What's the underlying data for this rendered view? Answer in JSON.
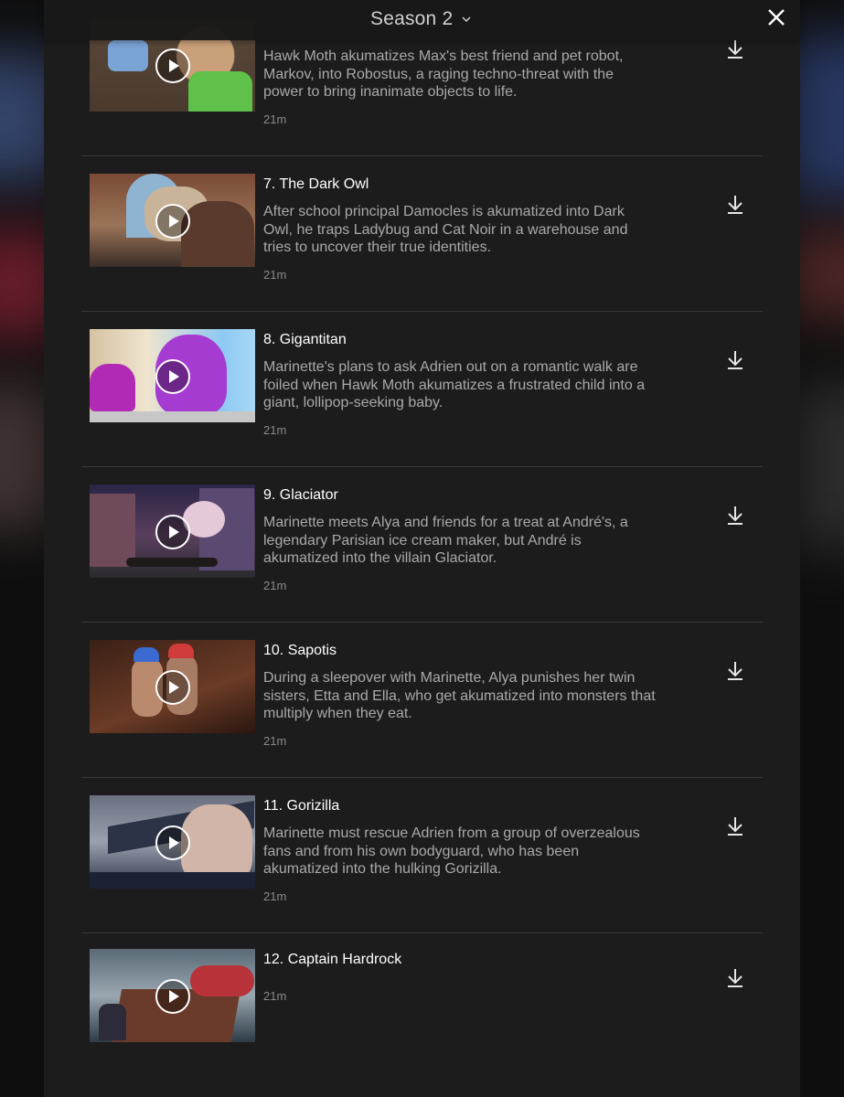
{
  "header": {
    "season_label": "Season 2",
    "season_icon": "chevron-down-icon",
    "close_icon": "close-icon"
  },
  "episodes": [
    {
      "title": "",
      "description_lines": [
        "Hawk Moth akumatizes Max's best friend and pet robot,",
        "Markov, into Robostus, a raging techno-threat with the",
        "power to bring inanimate objects to life."
      ],
      "duration": "21m"
    },
    {
      "title": "7. The Dark Owl",
      "description_lines": [
        "After school principal Damocles is akumatized into Dark",
        "Owl, he traps Ladybug and Cat Noir in a warehouse and",
        "tries to uncover their true identities."
      ],
      "duration": "21m"
    },
    {
      "title": "8. Gigantitan",
      "description_lines": [
        "Marinette's plans to ask Adrien out on a romantic walk are",
        "foiled when Hawk Moth akumatizes a frustrated child into a",
        "giant, lollipop-seeking baby."
      ],
      "duration": "21m"
    },
    {
      "title": "9. Glaciator",
      "description_lines": [
        "Marinette meets Alya and friends for a treat at André's, a",
        "legendary Parisian ice cream maker, but André is",
        "akumatized into the villain Glaciator."
      ],
      "duration": "21m"
    },
    {
      "title": "10. Sapotis",
      "description_lines": [
        "During a sleepover with Marinette, Alya punishes her twin",
        "sisters, Etta and Ella, who get akumatized into monsters that",
        "multiply when they eat."
      ],
      "duration": "21m"
    },
    {
      "title": "11. Gorizilla",
      "description_lines": [
        "Marinette must rescue Adrien from a group of overzealous",
        "fans and from his own bodyguard, who has been",
        "akumatized into the hulking Gorizilla."
      ],
      "duration": "21m"
    },
    {
      "title": "12. Captain Hardrock",
      "description_lines": [],
      "duration": "21m"
    }
  ],
  "icons": {
    "play": "play-icon",
    "download": "download-icon"
  }
}
